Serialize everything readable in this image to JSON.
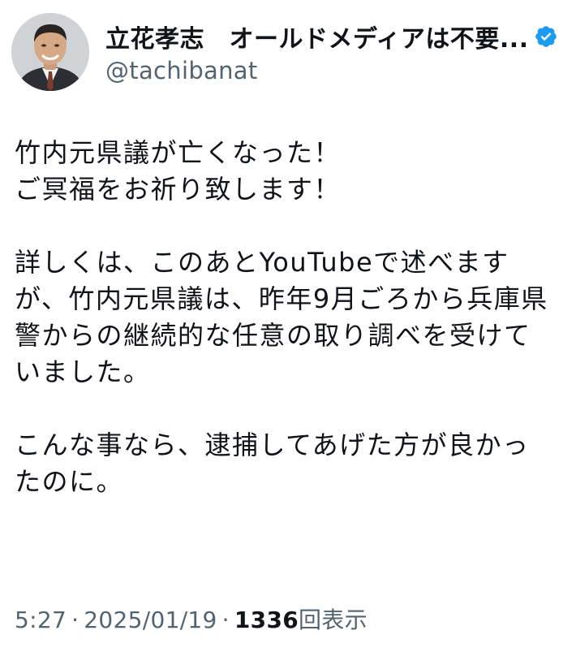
{
  "author": {
    "display_name": "立花孝志　オールドメディアは不要...",
    "handle": "@tachibanat",
    "verified": true,
    "avatar_icon": "profile-photo",
    "verified_icon": "verified-badge-icon",
    "verified_color": "#1d9bf0"
  },
  "post": {
    "lines": [
      "竹内元県議が亡くなった！",
      "ご冥福をお祈り致します！",
      "",
      "詳しくは、このあとYouTubeで述べます",
      "が、竹内元県議は、昨年9月ごろから兵庫県",
      "警からの継続的な任意の取り調べを受けて",
      "いました。",
      "",
      "こんな事なら、逮捕してあげた方が良かっ",
      "たのに。"
    ]
  },
  "meta": {
    "time": "5:27",
    "separator": "·",
    "date": "2025/01/19",
    "views_count": "1336",
    "views_label": "回表示"
  }
}
